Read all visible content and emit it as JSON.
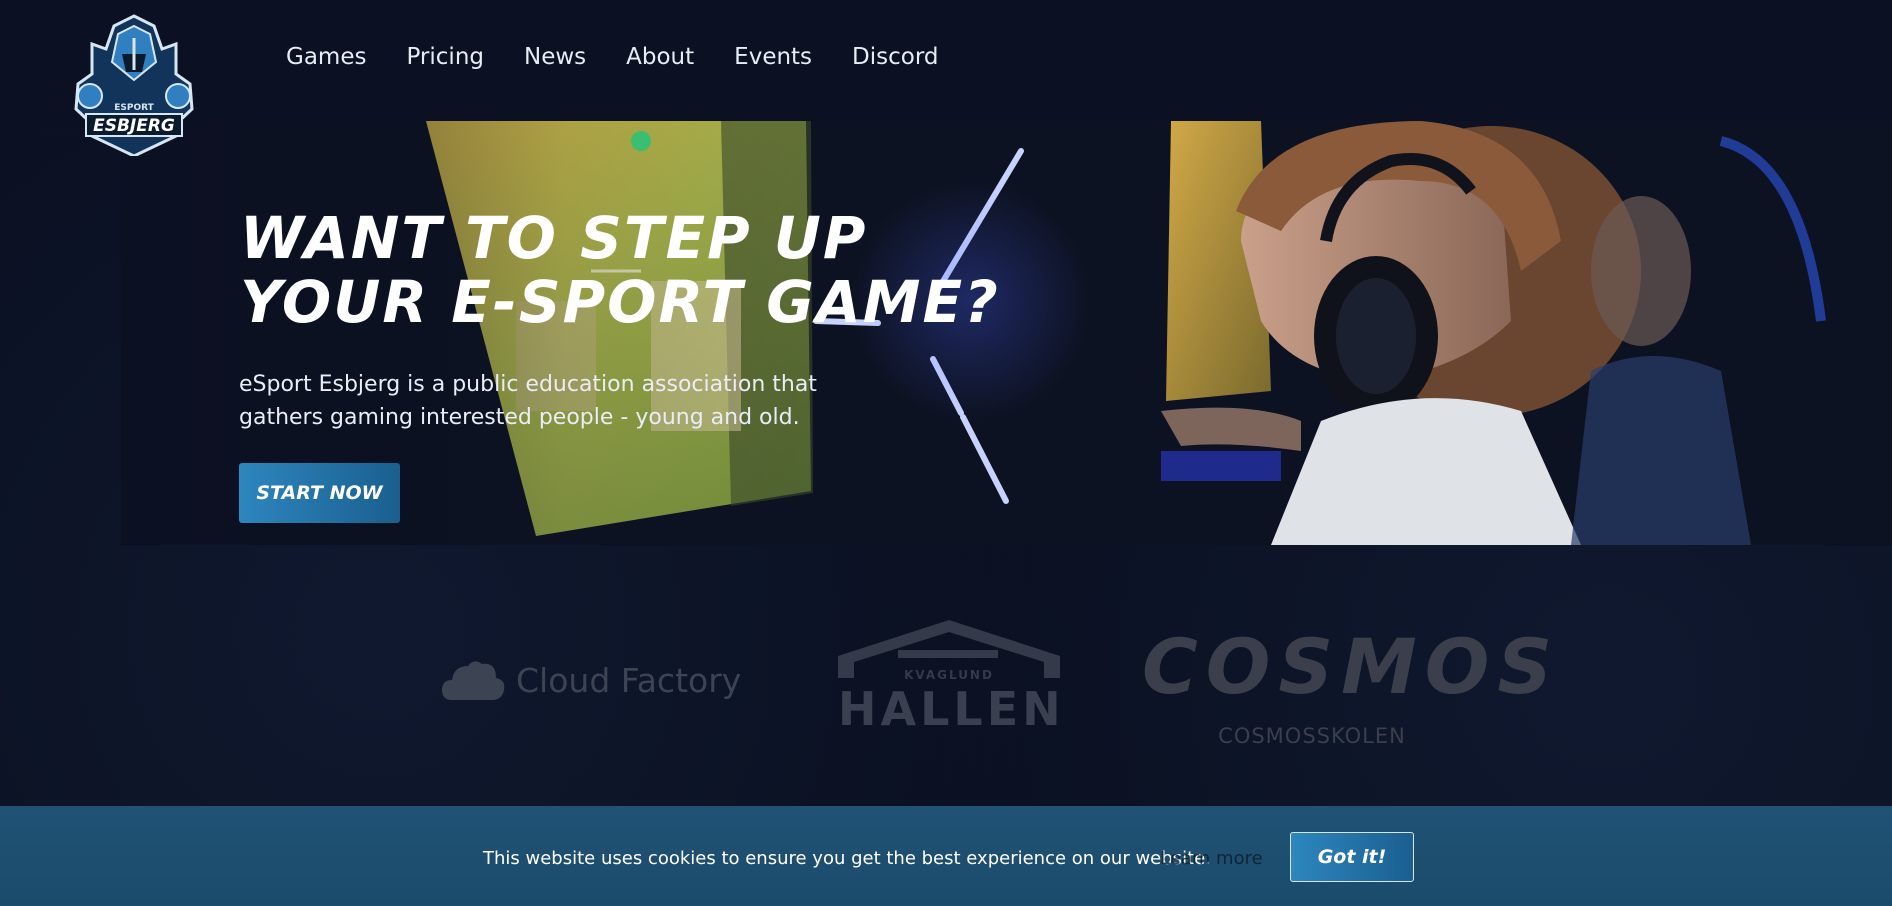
{
  "header": {
    "logo": {
      "top_text": "ESPORT",
      "main_text": "ESBJERG"
    },
    "nav": [
      {
        "label": "Games"
      },
      {
        "label": "Pricing"
      },
      {
        "label": "News"
      },
      {
        "label": "About"
      },
      {
        "label": "Events"
      },
      {
        "label": "Discord"
      }
    ]
  },
  "hero": {
    "headline_line1": "WANT TO STEP UP",
    "headline_line2": "YOUR E-SPORT GAME?",
    "subtext": "eSport Esbjerg is a public education association that gathers gaming interested people - young and old.",
    "cta_label": "START NOW"
  },
  "partners": {
    "cloud_factory": "Cloud Factory",
    "kvaglund": "KVAGLUND",
    "hallen": "HALLEN",
    "cosmos": "COSMOS",
    "cosmosskolen": "COSMOSSKOLEN"
  },
  "cookie": {
    "text": "This website uses cookies to ensure you get the best experience on our website.",
    "learn_more": "Learn more",
    "button": "Got it!"
  },
  "colors": {
    "background": "#0b1022",
    "accent": "#2d86be",
    "cookie_bar": "#1f5274",
    "neon": "#a9b8ff"
  }
}
